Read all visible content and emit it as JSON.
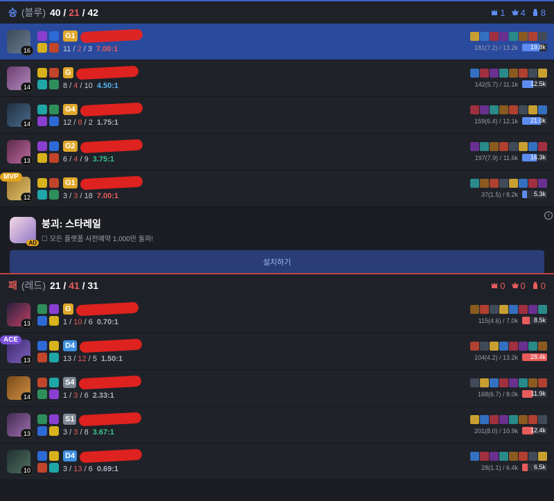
{
  "blue_team": {
    "result": "승",
    "name": "(블루)",
    "kills": "40",
    "deaths": "21",
    "assists": "42",
    "sep": "/",
    "objectives": {
      "baron": "1",
      "dragon": "4",
      "tower": "8"
    },
    "players": [
      {
        "level": "16",
        "tier": "G1",
        "kda": {
          "k": "11",
          "d": "2",
          "a": "3"
        },
        "ratio": "7.00:1",
        "ratio_color": "red",
        "cs": "181(7.2) / 13.2k",
        "damage": "19.8k",
        "damage_pct": 0.7,
        "highlight": true,
        "badge": ""
      },
      {
        "level": "14",
        "tier": "G",
        "kda": {
          "k": "8",
          "d": "4",
          "a": "10"
        },
        "ratio": "4.50:1",
        "ratio_color": "blue",
        "cs": "142(5.7) / 11.1k",
        "damage": "12.5k",
        "damage_pct": 0.44,
        "highlight": false,
        "badge": ""
      },
      {
        "level": "14",
        "tier": "G4",
        "kda": {
          "k": "12",
          "d": "8",
          "a": "2"
        },
        "ratio": "1.75:1",
        "ratio_color": "gray",
        "cs": "159(6.4) / 12.1k",
        "damage": "21.0k",
        "damage_pct": 0.74,
        "highlight": false,
        "badge": ""
      },
      {
        "level": "13",
        "tier": "G2",
        "kda": {
          "k": "6",
          "d": "4",
          "a": "9"
        },
        "ratio": "3.75:1",
        "ratio_color": "green",
        "cs": "197(7.9) / 11.6k",
        "damage": "16.3k",
        "damage_pct": 0.57,
        "highlight": false,
        "badge": ""
      },
      {
        "level": "12",
        "tier": "G1",
        "kda": {
          "k": "3",
          "d": "3",
          "a": "18"
        },
        "ratio": "7.00:1",
        "ratio_color": "red",
        "cs": "37(1.5) / 8.2k",
        "damage": "5.3k",
        "damage_pct": 0.19,
        "highlight": false,
        "badge": "MVP"
      }
    ]
  },
  "ad": {
    "title": "붕괴: 스타레일",
    "subtitle": "모든 플랫폼 사전예약 1,000만 돌파!",
    "tag": "AD",
    "button": "설치하기",
    "info": "i"
  },
  "red_team": {
    "result": "패",
    "name": "(레드)",
    "kills": "21",
    "deaths": "41",
    "assists": "31",
    "sep": "/",
    "objectives": {
      "baron": "0",
      "dragon": "0",
      "tower": "0"
    },
    "players": [
      {
        "level": "13",
        "tier": "G",
        "kda": {
          "k": "1",
          "d": "10",
          "a": "6"
        },
        "ratio": "0.70:1",
        "ratio_color": "gray",
        "cs": "115(4.6) / 7.0k",
        "damage": "8.5k",
        "damage_pct": 0.3,
        "highlight": false,
        "badge": ""
      },
      {
        "level": "13",
        "tier": "D4",
        "kda": {
          "k": "13",
          "d": "12",
          "a": "5"
        },
        "ratio": "1.50:1",
        "ratio_color": "gray",
        "cs": "104(4.2) / 13.2k",
        "damage": "28.4k",
        "damage_pct": 1.0,
        "highlight": false,
        "badge": "ACE"
      },
      {
        "level": "14",
        "tier": "S4",
        "kda": {
          "k": "1",
          "d": "3",
          "a": "6"
        },
        "ratio": "2.33:1",
        "ratio_color": "gray",
        "cs": "168(6.7) / 8.0k",
        "damage": "11.9k",
        "damage_pct": 0.42,
        "highlight": false,
        "badge": ""
      },
      {
        "level": "13",
        "tier": "S1",
        "kda": {
          "k": "3",
          "d": "3",
          "a": "8"
        },
        "ratio": "3.67:1",
        "ratio_color": "green",
        "cs": "201(8.0) / 10.9k",
        "damage": "12.4k",
        "damage_pct": 0.44,
        "highlight": false,
        "badge": ""
      },
      {
        "level": "10",
        "tier": "D4",
        "kda": {
          "k": "3",
          "d": "13",
          "a": "6"
        },
        "ratio": "0.69:1",
        "ratio_color": "gray",
        "cs": "28(1.1) / 6.4k",
        "damage": "6.5k",
        "damage_pct": 0.23,
        "highlight": false,
        "badge": ""
      }
    ]
  },
  "colors": {
    "blue": "#5d8cf0",
    "red": "#e75c5c",
    "highlight": "#2a4a9e",
    "gold": "#e0a82a",
    "diamond": "#3d8fe0",
    "silver": "#7e8794"
  },
  "icons": {
    "baron": "baron-icon",
    "dragon": "dragon-icon",
    "tower": "tower-icon"
  }
}
